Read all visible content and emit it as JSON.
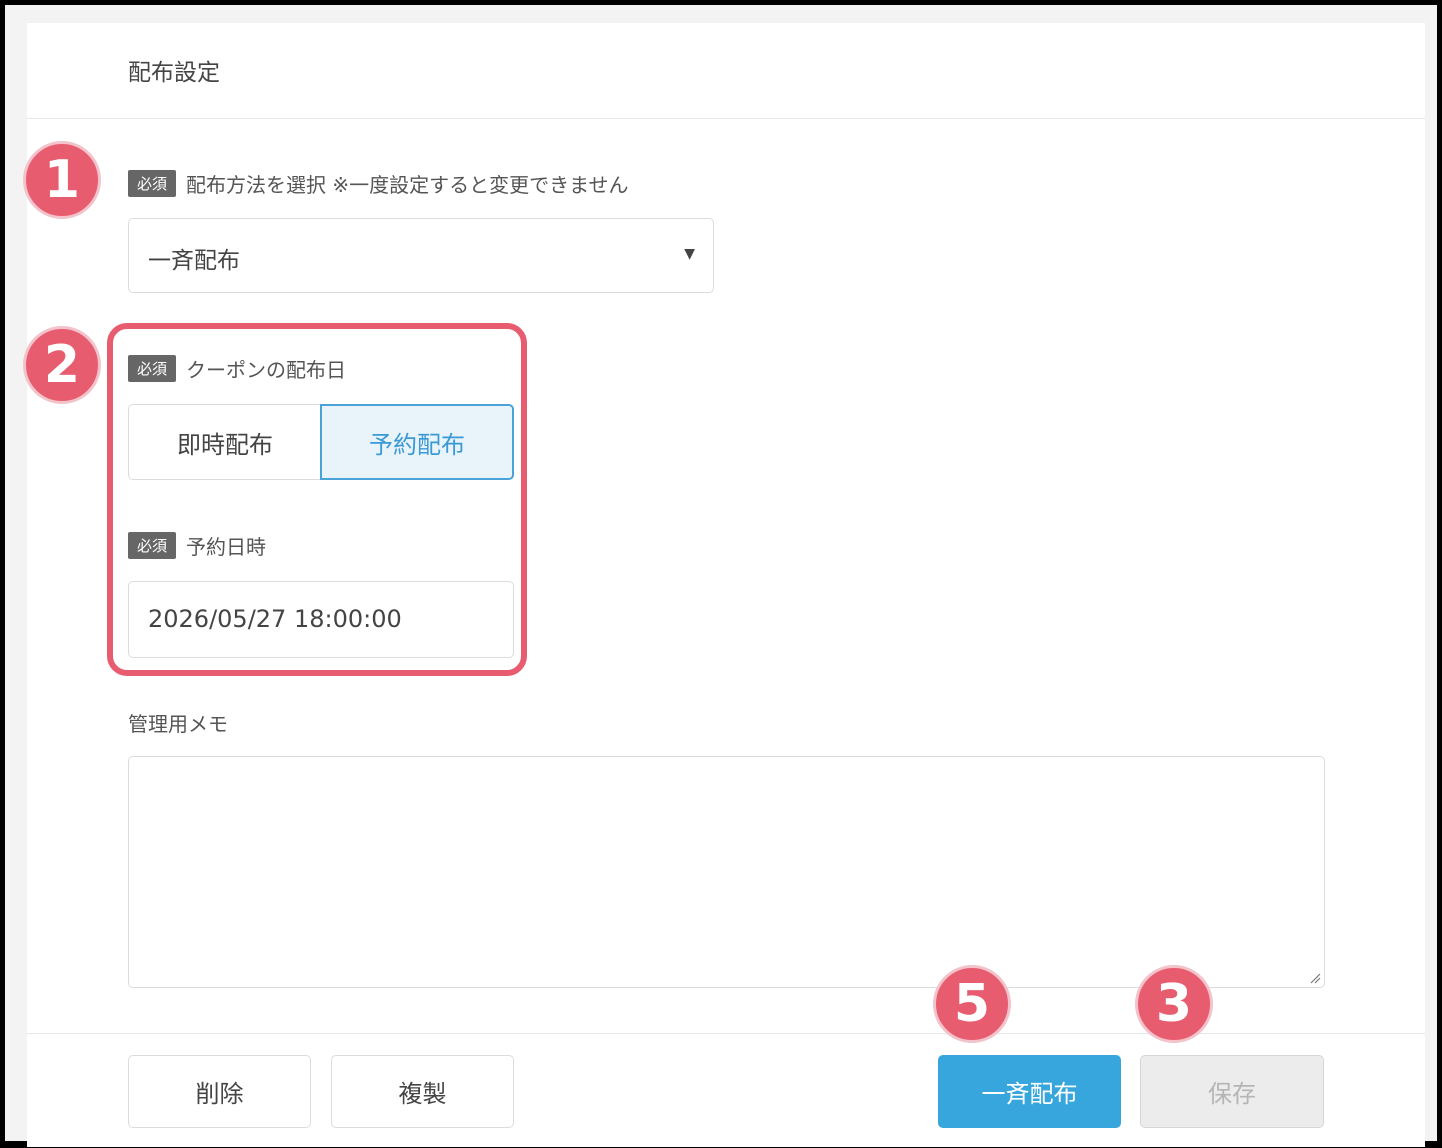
{
  "card": {
    "title": "配布設定"
  },
  "method": {
    "required_tag": "必須",
    "label": "配布方法を選択 ※一度設定すると変更できません",
    "selected": "一斉配布"
  },
  "distribution_date": {
    "required_tag": "必須",
    "label": "クーポンの配布日",
    "options": [
      "即時配布",
      "予約配布"
    ],
    "selected_index": 1
  },
  "reservation": {
    "required_tag": "必須",
    "label": "予約日時",
    "value": "2026/05/27 18:00:00"
  },
  "memo": {
    "label": "管理用メモ",
    "value": ""
  },
  "footer": {
    "delete_label": "削除",
    "copy_label": "複製",
    "distribute_label": "一斉配布",
    "save_label": "保存"
  },
  "annotations": {
    "badge_1": "1",
    "badge_2": "2",
    "badge_3": "3",
    "badge_5": "5"
  },
  "colors": {
    "primary": "#36a6dd",
    "highlight": "#e85c6f",
    "selected_segment": "#3b9ad6"
  }
}
